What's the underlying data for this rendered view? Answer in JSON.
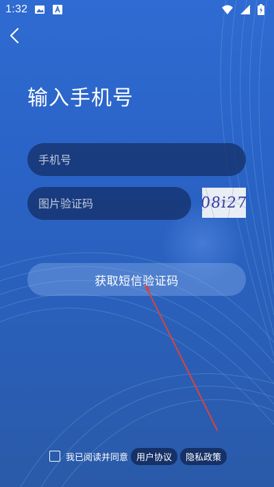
{
  "status_bar": {
    "time": "1:32",
    "icons": [
      "image-icon",
      "a-box-icon",
      "wifi-icon",
      "signal-icon",
      "battery-charging-icon"
    ]
  },
  "header": {
    "back_icon": "chevron-left-icon",
    "title": "输入手机号"
  },
  "form": {
    "phone_placeholder": "手机号",
    "captcha_placeholder": "图片验证码",
    "captcha_text": "08i27",
    "submit_label": "获取短信验证码"
  },
  "agreement": {
    "text": "我已阅读并同意",
    "user_agreement": "用户协议",
    "privacy_policy": "隐私政策"
  },
  "colors": {
    "background_top": "#2f6bd2",
    "background_bottom": "#2a5aa8",
    "input_bg": "#142d64",
    "annotation_line": "#d9443a"
  }
}
